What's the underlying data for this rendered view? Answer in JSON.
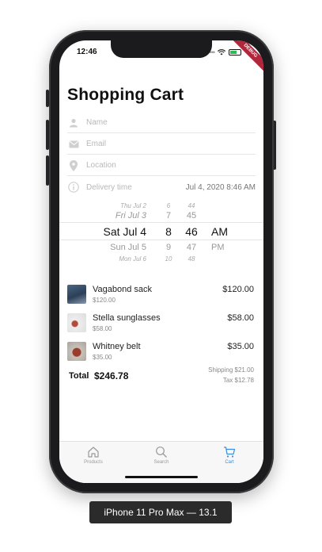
{
  "status_bar": {
    "time": "12:46",
    "debug_label": "DEBUG"
  },
  "header": {
    "title": "Shopping Cart"
  },
  "form": {
    "name_placeholder": "Name",
    "email_placeholder": "Email",
    "location_placeholder": "Location",
    "delivery_label": "Delivery time",
    "delivery_value": "Jul 4, 2020 8:46 AM"
  },
  "picker": {
    "rows": [
      {
        "date": "Thu Jul 2",
        "hour": "6",
        "minute": "44",
        "ampm": ""
      },
      {
        "date": "Fri Jul 3",
        "hour": "7",
        "minute": "45",
        "ampm": ""
      },
      {
        "date": "Sat Jul 4",
        "hour": "8",
        "minute": "46",
        "ampm": "AM"
      },
      {
        "date": "Sun Jul 5",
        "hour": "9",
        "minute": "47",
        "ampm": "PM"
      },
      {
        "date": "Mon Jul 6",
        "hour": "10",
        "minute": "48",
        "ampm": ""
      }
    ]
  },
  "cart": {
    "items": [
      {
        "name": "Vagabond sack",
        "unit_price": "$120.00",
        "price": "$120.00"
      },
      {
        "name": "Stella sunglasses",
        "unit_price": "$58.00",
        "price": "$58.00"
      },
      {
        "name": "Whitney belt",
        "unit_price": "$35.00",
        "price": "$35.00"
      }
    ],
    "total_label": "Total",
    "total_value": "$246.78",
    "shipping": "Shipping $21.00",
    "tax": "Tax $12.78"
  },
  "tabs": [
    {
      "label": "Products",
      "icon": "home-icon",
      "active": false
    },
    {
      "label": "Search",
      "icon": "search-icon",
      "active": false
    },
    {
      "label": "Cart",
      "icon": "cart-icon",
      "active": true
    }
  ],
  "caption": "iPhone 11 Pro Max — 13.1",
  "colors": {
    "accent": "#3b8ee0",
    "debug": "#b2263b",
    "frame": "#1b1b1d"
  }
}
